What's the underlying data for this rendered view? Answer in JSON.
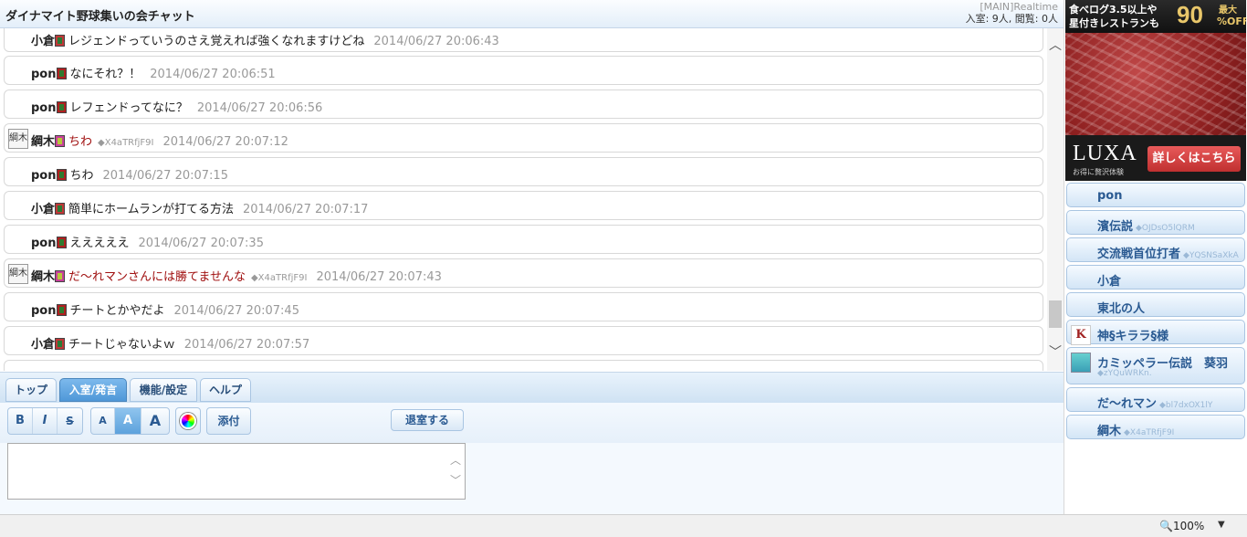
{
  "header": {
    "title": "ダイナマイト野球集いの会チャット",
    "mode": "[MAIN]Realtime",
    "stats": "入室: 9人, 閲覧: 0人"
  },
  "messages": [
    {
      "user": "小倉",
      "mark": "green",
      "text": "レジェンドっていうのさえ覚えれば強くなれますけどね",
      "time": "2014/06/27 20:06:43",
      "trip": "",
      "avatar": "",
      "text_color": "normal"
    },
    {
      "user": "pon",
      "mark": "red",
      "text": "なにそれ？！",
      "time": "2014/06/27 20:06:51",
      "trip": "",
      "avatar": "",
      "text_color": "normal"
    },
    {
      "user": "pon",
      "mark": "red",
      "text": "レフェンドってなに？",
      "time": "2014/06/27 20:06:56",
      "trip": "",
      "avatar": "",
      "text_color": "normal"
    },
    {
      "user": "綱木",
      "mark": "yellow",
      "text": "ちわ",
      "time": "2014/06/27 20:07:12",
      "trip": "◆X4aTRfjF9I",
      "avatar": "綱木",
      "text_color": "red"
    },
    {
      "user": "pon",
      "mark": "red",
      "text": "ちわ",
      "time": "2014/06/27 20:07:15",
      "trip": "",
      "avatar": "",
      "text_color": "normal"
    },
    {
      "user": "小倉",
      "mark": "green",
      "text": "簡単にホームランが打てる方法",
      "time": "2014/06/27 20:07:17",
      "trip": "",
      "avatar": "",
      "text_color": "normal"
    },
    {
      "user": "pon",
      "mark": "red",
      "text": "えええええ",
      "time": "2014/06/27 20:07:35",
      "trip": "",
      "avatar": "",
      "text_color": "normal"
    },
    {
      "user": "綱木",
      "mark": "yellow",
      "text": "だ〜れマンさんには勝てませんな",
      "time": "2014/06/27 20:07:43",
      "trip": "◆X4aTRfjF9I",
      "avatar": "綱木",
      "text_color": "red"
    },
    {
      "user": "pon",
      "mark": "red",
      "text": "チートとかやだよ",
      "time": "2014/06/27 20:07:45",
      "trip": "",
      "avatar": "",
      "text_color": "normal"
    },
    {
      "user": "小倉",
      "mark": "green",
      "text": "チートじゃないよｗ",
      "time": "2014/06/27 20:07:57",
      "trip": "",
      "avatar": "",
      "text_color": "normal"
    }
  ],
  "tabs": [
    {
      "label": "トップ",
      "active": false
    },
    {
      "label": "入室/発言",
      "active": true
    },
    {
      "label": "機能/設定",
      "active": false
    },
    {
      "label": "ヘルプ",
      "active": false
    }
  ],
  "toolbar": {
    "bold": "B",
    "italic": "I",
    "strike": "S",
    "size_small": "A",
    "size_medium": "A",
    "size_large": "A",
    "attach": "添付",
    "leave": "退室する"
  },
  "input": {
    "value": ""
  },
  "ad": {
    "line1": "食べログ3.5以上や",
    "line2": "星付きレストランも",
    "discount": "90",
    "max": "最大",
    "off": "%OFF",
    "brand": "LUXA",
    "tagline": "お得に贅沢体験",
    "cta": "詳しくはこちら"
  },
  "users": [
    {
      "name": "pon",
      "trip": "",
      "avatar": ""
    },
    {
      "name": "濱伝説",
      "trip": "◆OJDsO5lQRM",
      "avatar": ""
    },
    {
      "name": "交流戦首位打者",
      "trip": "◆YQSNSaXkA",
      "avatar": ""
    },
    {
      "name": "小倉",
      "trip": "",
      "avatar": ""
    },
    {
      "name": "東北の人",
      "trip": "",
      "avatar": ""
    },
    {
      "name": "神§キララ§様",
      "trip": "",
      "avatar": "kirara"
    },
    {
      "name": "カミッペラー伝説　葵羽",
      "trip": "◆zYQuWRKn.",
      "avatar": "miku"
    },
    {
      "name": "だ〜れマン",
      "trip": "◆bl7dxOX1lY",
      "avatar": ""
    },
    {
      "name": "綱木",
      "trip": "◆X4aTRfjF9I",
      "avatar": ""
    }
  ],
  "status": {
    "zoom": "100%"
  }
}
